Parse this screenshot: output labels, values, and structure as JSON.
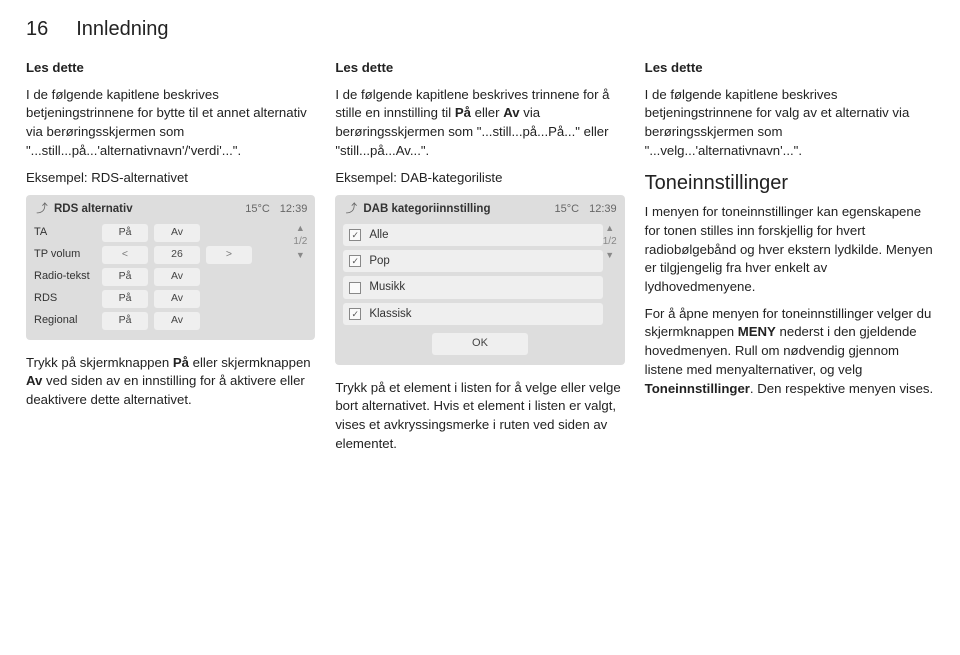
{
  "header": {
    "pagenum": "16",
    "chapter": "Innledning"
  },
  "col1": {
    "les_dette": "Les dette",
    "p1": "I de følgende kapitlene beskrives betjeningstrinnene for bytte til et annet alternativ via berøringsskjermen som \"...still...på...'alternativnavn'/'verdi'...\".",
    "p2": "Eksempel: RDS-alternativet",
    "panel": {
      "back": "⤴",
      "title": "RDS alternativ",
      "temp": "15°C",
      "clock": "12:39",
      "pager": "1/2",
      "rows": [
        {
          "label": "TA",
          "left": "På",
          "right": "Av"
        },
        {
          "label": "TP volum",
          "arrowL": "<",
          "num": "26",
          "arrowR": ">"
        },
        {
          "label": "Radio-tekst",
          "left": "På",
          "right": "Av"
        },
        {
          "label": "RDS",
          "left": "På",
          "right": "Av"
        },
        {
          "label": "Regional",
          "left": "På",
          "right": "Av"
        }
      ]
    },
    "p3a": "Trykk på skjermknappen ",
    "p3b": "På",
    "p3c": " eller skjermknappen ",
    "p3d": "Av",
    "p3e": " ved siden av en innstilling for å aktivere eller deaktivere dette alternativet."
  },
  "col2": {
    "les_dette": "Les dette",
    "p1a": "I de følgende kapitlene beskrives trinnene for å stille en innstilling til ",
    "p1b": "På",
    "p1c": " eller ",
    "p1d": "Av",
    "p1e": " via berøringsskjermen som \"...still...på...På...\" eller \"still...på...Av...\".",
    "p2": "Eksempel: DAB-kategoriliste",
    "panel": {
      "back": "⤴",
      "title": "DAB kategoriinnstilling",
      "temp": "15°C",
      "clock": "12:39",
      "pager": "1/2",
      "items": [
        {
          "label": "Alle",
          "checked": true
        },
        {
          "label": "Pop",
          "checked": true
        },
        {
          "label": "Musikk",
          "checked": false
        },
        {
          "label": "Klassisk",
          "checked": true
        }
      ],
      "ok": "OK"
    },
    "p3": "Trykk på et element i listen for å velge eller velge bort alternativet. Hvis et element i listen er valgt, vises et avkryssingsmerke i ruten ved siden av elementet."
  },
  "col3": {
    "les_dette": "Les dette",
    "p1": "I de følgende kapitlene beskrives betjeningstrinnene for valg av et alternativ via berøringsskjermen som \"...velg...'alternativnavn'...\".",
    "heading": "Toneinnstillinger",
    "p2": "I menyen for toneinnstillinger kan egenskapene for tonen stilles inn forskjellig for hvert radiobølgebånd og hver ekstern lydkilde. Menyen er tilgjengelig fra hver enkelt av lydhovedmenyene.",
    "p3a": "For å åpne menyen for toneinnstillinger velger du skjermknappen ",
    "p3b": "MENY",
    "p3c": " nederst i den gjeldende hovedmenyen. Rull om nødvendig gjennom listene med menyalternativer, og velg ",
    "p3d": "Toneinnstillinger",
    "p3e": ". Den respektive menyen vises."
  }
}
